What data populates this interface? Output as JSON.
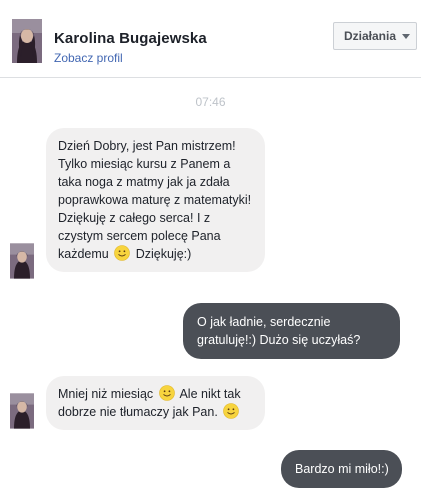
{
  "header": {
    "name": "Karolina Bugajewska",
    "profile_link": "Zobacz profil",
    "actions_label": "Działania"
  },
  "conversation": {
    "timestamp": "07:46",
    "messages": [
      {
        "direction": "incoming",
        "lines": [
          "Dzień Dobry, jest Pan mistrzem!",
          "Tylko miesiąc kursu z Panem a",
          "taka noga z matmy jak ja zdała",
          "poprawkowa maturę z matematyki!",
          "Dziękuję z całego serca! I z",
          "czystym sercem polecę Pana"
        ],
        "last_before_emoji": "każdemu",
        "last_after_emoji": "Dziękuję:)"
      },
      {
        "direction": "outgoing",
        "lines": [
          "O jak ładnie, serdecznie",
          "gratuluję!:) Dużo się uczyłaś?"
        ]
      },
      {
        "direction": "incoming",
        "line1_before_emoji": "Mniej niż miesiąc",
        "line1_after_emoji": "Ale nikt tak",
        "line2": "dobrze nie tłumaczy jak Pan."
      },
      {
        "direction": "outgoing",
        "lines": [
          "Bardzo mi miło!:)"
        ]
      }
    ]
  },
  "colors": {
    "incoming_bubble": "#f1f0f0",
    "outgoing_bubble": "#4b4f56",
    "link": "#4267b2",
    "timestamp": "#bec3c9"
  },
  "icons": {
    "emoji": "slightly-smiling-face-icon",
    "avatar": "user-avatar"
  }
}
